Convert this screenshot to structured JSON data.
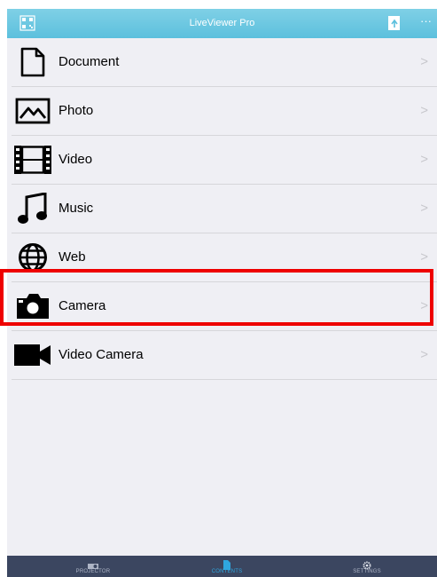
{
  "app": {
    "title": "LiveViewer Pro",
    "more_label": "···"
  },
  "content_list": [
    {
      "label": "Document",
      "icon": "document-icon"
    },
    {
      "label": "Photo",
      "icon": "photo-icon"
    },
    {
      "label": "Video",
      "icon": "film-icon"
    },
    {
      "label": "Music",
      "icon": "music-note-icon"
    },
    {
      "label": "Web",
      "icon": "globe-icon"
    },
    {
      "label": "Camera",
      "icon": "camera-icon"
    },
    {
      "label": "Video Camera",
      "icon": "video-camera-icon"
    }
  ],
  "chevron": ">",
  "tabs": [
    {
      "label": "PROJECTOR",
      "icon": "projector-icon"
    },
    {
      "label": "CONTENTS",
      "icon": "document-icon",
      "selected": true
    },
    {
      "label": "SETTINGS",
      "icon": "gear-icon"
    }
  ],
  "colors": {
    "navbar": "#5cc0dd",
    "tabbar": "#3b4660",
    "active_tab": "#2fa7e0",
    "highlight": "#ee0000"
  }
}
